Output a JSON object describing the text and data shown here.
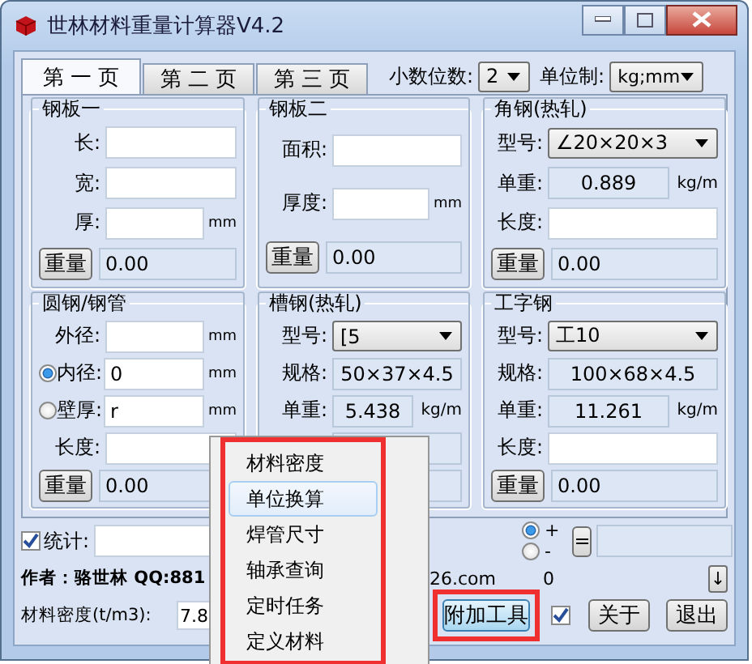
{
  "window": {
    "title": "世林材料重量计算器V4.2"
  },
  "tabs": [
    {
      "label": "第 一 页",
      "selected": true
    },
    {
      "label": "第 二 页",
      "selected": false
    },
    {
      "label": "第 三 页",
      "selected": false
    }
  ],
  "decimal_places": {
    "label": "小数位数:",
    "value": "2"
  },
  "unit_system": {
    "label": "单位制:",
    "value": "kg;mm"
  },
  "groups": [
    {
      "title": "钢板一",
      "rows": [
        {
          "kind": "input",
          "label": "长:",
          "value": ""
        },
        {
          "kind": "input",
          "label": "宽:",
          "value": ""
        },
        {
          "kind": "input",
          "label": "厚:",
          "value": "",
          "unit": "mm"
        },
        {
          "kind": "result",
          "button": "重量",
          "value": "0.00"
        }
      ]
    },
    {
      "title": "钢板二",
      "rows": [
        {
          "kind": "input",
          "label": "面积:",
          "value": ""
        },
        {
          "kind": "input",
          "label": "厚度:",
          "value": "",
          "unit": "mm"
        },
        {
          "kind": "result",
          "button": "重量",
          "value": "0.00"
        }
      ]
    },
    {
      "title": "角钢(热轧)",
      "rows": [
        {
          "kind": "select",
          "label": "型号:",
          "value": "∠20×20×3"
        },
        {
          "kind": "readout",
          "label": "单重:",
          "value": "0.889",
          "unit": "kg/m"
        },
        {
          "kind": "input",
          "label": "长度:",
          "value": ""
        },
        {
          "kind": "result",
          "button": "重量",
          "value": "0.00"
        }
      ]
    },
    {
      "title": "圆钢/钢管",
      "rows": [
        {
          "kind": "input",
          "label": "外径:",
          "value": "",
          "unit": "mm"
        },
        {
          "kind": "radio",
          "label": "内径:",
          "selected": true,
          "value": "0",
          "unit": "mm"
        },
        {
          "kind": "radio",
          "label": "壁厚:",
          "selected": false,
          "value": "r",
          "unit": "mm"
        },
        {
          "kind": "input",
          "label": "长度:",
          "value": ""
        },
        {
          "kind": "result",
          "button": "重量",
          "value": "0.00"
        }
      ]
    },
    {
      "title": "槽钢(热轧)",
      "rows": [
        {
          "kind": "select",
          "label": "型号:",
          "value": "[5"
        },
        {
          "kind": "readout",
          "label": "规格:",
          "value": "50×37×4.5"
        },
        {
          "kind": "readout",
          "label": "单重:",
          "value": "5.438",
          "unit": "kg/m"
        },
        {
          "kind": "covered"
        },
        {
          "kind": "covered"
        }
      ]
    },
    {
      "title": "工字钢",
      "rows": [
        {
          "kind": "select",
          "label": "型号:",
          "value": "工10"
        },
        {
          "kind": "readout",
          "label": "规格:",
          "value": "100×68×4.5"
        },
        {
          "kind": "readout",
          "label": "单重:",
          "value": "11.261",
          "unit": "kg/m"
        },
        {
          "kind": "input",
          "label": "长度:",
          "value": ""
        },
        {
          "kind": "result",
          "button": "重量",
          "value": "0.00"
        }
      ]
    }
  ],
  "statistics": {
    "label": "统计:",
    "checked": true
  },
  "operators": [
    {
      "label": "+",
      "selected": true
    },
    {
      "label": "-",
      "selected": false
    }
  ],
  "equals_button": "=",
  "author": "作者：骆世林 QQ:881",
  "author_tail": "26.com",
  "counter": "0",
  "scroll_button": "↓",
  "density": {
    "label": "材料密度(t/m3):",
    "value": "7.8"
  },
  "tools_button": "附加工具",
  "topmost": {
    "checked": true
  },
  "about_button": "关于",
  "exit_button": "退出",
  "menu": [
    {
      "label": "材料密度",
      "selected": false
    },
    {
      "label": "单位换算",
      "selected": true
    },
    {
      "label": "焊管尺寸",
      "selected": false
    },
    {
      "label": "轴承查询",
      "selected": false
    },
    {
      "label": "定时任务",
      "selected": false
    },
    {
      "label": "定义材料",
      "selected": false
    }
  ]
}
